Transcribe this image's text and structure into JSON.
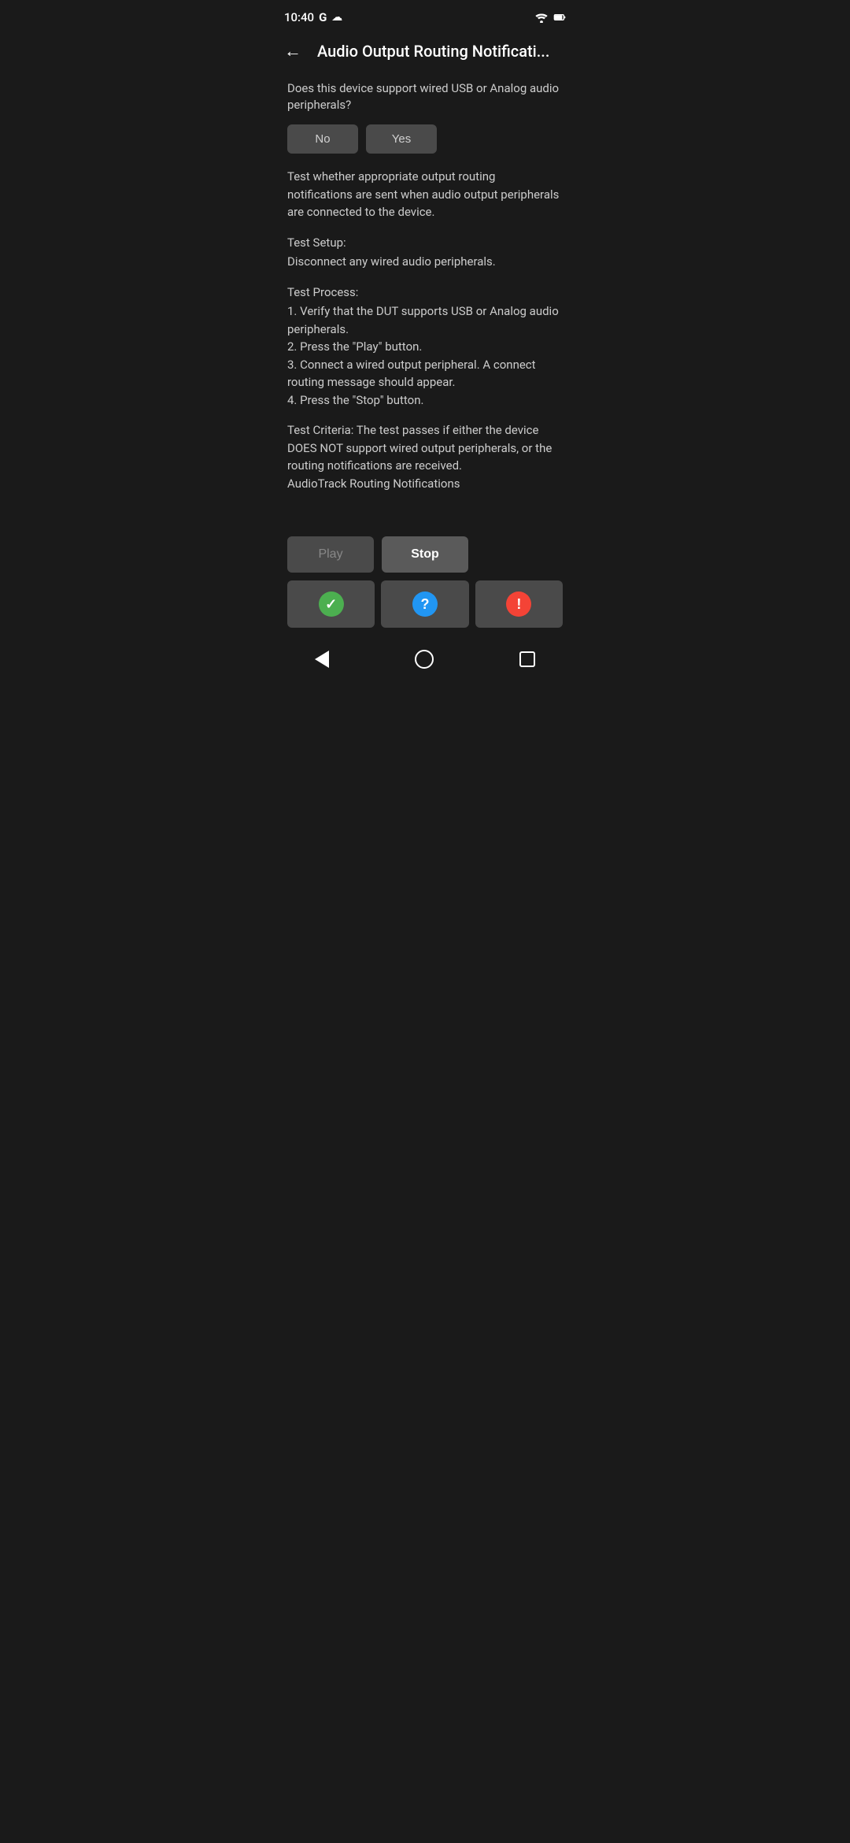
{
  "statusBar": {
    "time": "10:40",
    "googleIcon": "G",
    "cloudIcon": "☁",
    "wifiIcon": "▲",
    "batteryIcon": "🔋"
  },
  "toolbar": {
    "backIcon": "←",
    "title": "Audio Output Routing Notificati..."
  },
  "content": {
    "question": "Does this device support wired USB or Analog audio peripherals?",
    "noLabel": "No",
    "yesLabel": "Yes",
    "description": "Test whether appropriate output routing notifications are sent when audio output peripherals are connected to the device.",
    "testSetupTitle": "Test Setup:",
    "testSetupBody": "Disconnect any wired audio peripherals.",
    "testProcessTitle": "Test Process:",
    "testProcessBody": "1. Verify that the DUT supports USB or Analog audio peripherals.\n2. Press the \"Play\" button.\n3. Connect a wired output peripheral. A connect routing message should appear.\n4. Press the \"Stop\" button.",
    "testCriteriaTitle": "Test Criteria:",
    "testCriteriaBody": "The test passes if either the device DOES NOT support wired output peripherals, or the routing notifications are received.\nAudioTrack Routing Notifications"
  },
  "controls": {
    "playLabel": "Play",
    "stopLabel": "Stop",
    "passIcon": "✓",
    "infoIcon": "?",
    "failIcon": "!"
  },
  "navBar": {
    "backIcon": "back",
    "homeIcon": "home",
    "recentIcon": "recent"
  }
}
